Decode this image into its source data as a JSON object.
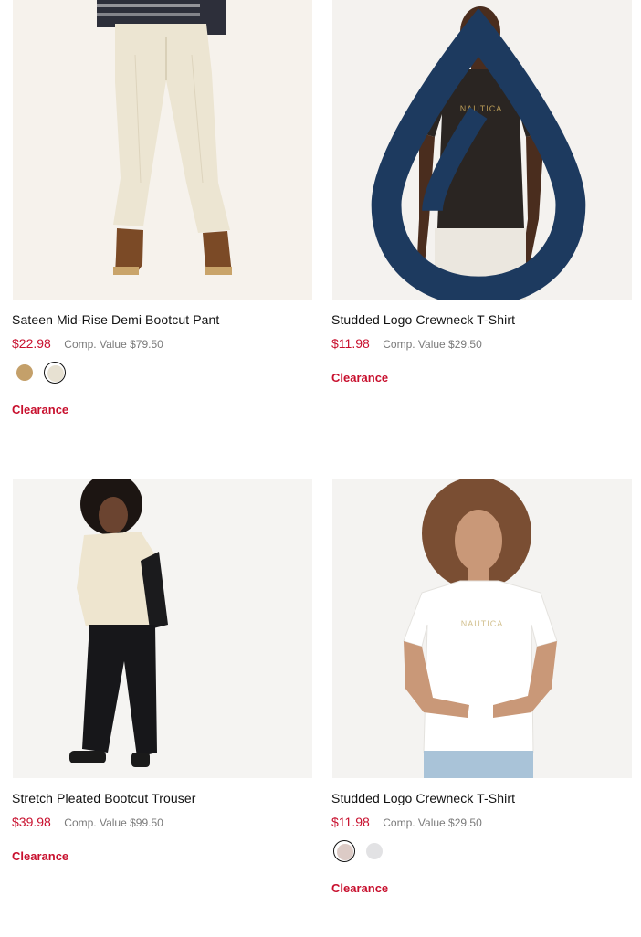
{
  "products": [
    {
      "name": "Sateen Mid-Rise Demi Bootcut Pant",
      "price": "$22.98",
      "comp_value": "Comp. Value $79.50",
      "badge": "Clearance",
      "swatches": [
        {
          "color": "#c4a06a",
          "selected": false
        },
        {
          "color": "#e7e1d2",
          "selected": true
        }
      ]
    },
    {
      "name": "Studded Logo Crewneck T-Shirt",
      "price": "$11.98",
      "comp_value": "Comp. Value $29.50",
      "badge": "Clearance",
      "image_text": "NAUTICA",
      "icon": "water-drop-icon",
      "swatches": []
    },
    {
      "name": "Stretch Pleated Bootcut Trouser",
      "price": "$39.98",
      "comp_value": "Comp. Value $99.50",
      "badge": "Clearance",
      "swatches": []
    },
    {
      "name": "Studded Logo Crewneck T-Shirt",
      "price": "$11.98",
      "comp_value": "Comp. Value $29.50",
      "badge": "Clearance",
      "image_text": "NAUTICA",
      "swatches": [
        {
          "color": "#dccbc6",
          "selected": true
        },
        {
          "color": "#e2e2e4",
          "selected": false
        }
      ]
    }
  ]
}
